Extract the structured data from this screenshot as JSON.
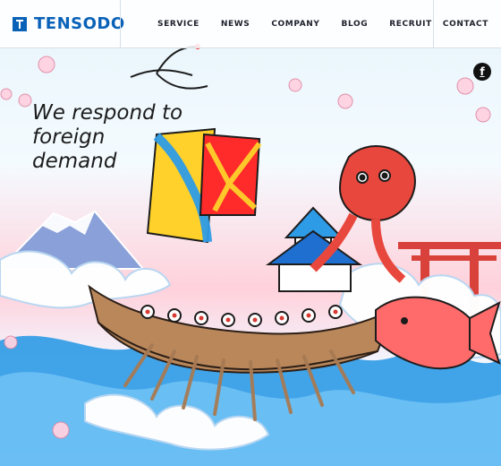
{
  "brand": {
    "name": "TENSODO"
  },
  "nav": {
    "items": [
      "SERVICE",
      "NEWS",
      "COMPANY",
      "BLOG",
      "RECRUIT"
    ],
    "contact": "CONTACT"
  },
  "social": {
    "facebook_label": "f"
  },
  "hero": {
    "headline_lines": [
      "We respond to",
      "foreign",
      "demand"
    ]
  },
  "colors": {
    "brand_blue": "#0a62b8",
    "text_dark": "#1c1c1c",
    "wave_blue": "#2e9be6",
    "sun_red": "#ff2a2a",
    "octopus_red": "#e8473d"
  },
  "icons": {
    "logo": "tensodo-logo-mark",
    "facebook": "facebook-icon"
  }
}
